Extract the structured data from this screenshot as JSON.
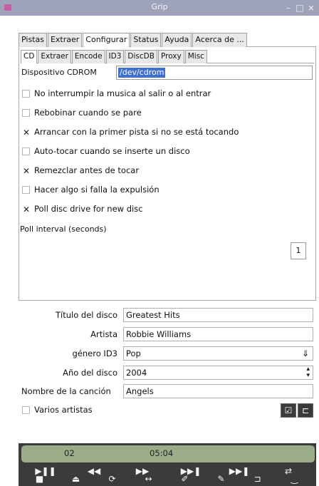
{
  "window": {
    "title": "Grip",
    "controls": {
      "minimize": "–",
      "maximize": "□",
      "close": "×"
    }
  },
  "top_tabs": [
    "Pistas",
    "Extraer",
    "Configurar",
    "Status",
    "Ayuda",
    "Acerca de ..."
  ],
  "top_tabs_active": "Configurar",
  "sub_tabs": [
    "CD",
    "Extraer",
    "Encode",
    "ID3",
    "DiscDB",
    "Proxy",
    "Misc"
  ],
  "sub_tabs_active": "CD",
  "cd": {
    "device_label": "Dispositivo CDROM",
    "device_value": "/dev/cdrom",
    "options": [
      {
        "label": "No interrumpir la musica al salir o al entrar",
        "checked": false
      },
      {
        "label": "Rebobinar cuando se pare",
        "checked": false
      },
      {
        "label": "Arrancar con la primer pista si no se está tocando",
        "checked": true
      },
      {
        "label": "Auto-tocar cuando se inserte un disco",
        "checked": false
      },
      {
        "label": "Remezclar antes de tocar",
        "checked": true
      },
      {
        "label": "Hacer algo si falla la expulsión",
        "checked": false
      },
      {
        "label": "Poll disc drive for new disc",
        "checked": true
      }
    ],
    "poll_interval_label": "Poll interval (seconds)",
    "poll_interval_value": "1"
  },
  "disc_info": {
    "title_label": "Título del disco",
    "title_value": "Greatest Hits",
    "artist_label": "Artista",
    "artist_value": "Robbie Williams",
    "genre_label": "género ID3",
    "genre_value": "Pop",
    "year_label": "Año del disco",
    "year_value": "2004",
    "song_label": "Nombre de la canción",
    "song_value": "Angels",
    "various_label": "Varios artistas",
    "various_checked": false
  },
  "player": {
    "track": "02",
    "time": "05:04",
    "progress": 0.0,
    "row1": [
      "play-pause",
      "rewind",
      "fast-forward",
      "previous-track",
      "next-track",
      "shuffle"
    ],
    "row2": [
      "stop",
      "eject",
      "repeat",
      "playlist",
      "edit",
      "discdb",
      "toggle-view",
      "minimize"
    ],
    "accent": "#9aac88"
  }
}
